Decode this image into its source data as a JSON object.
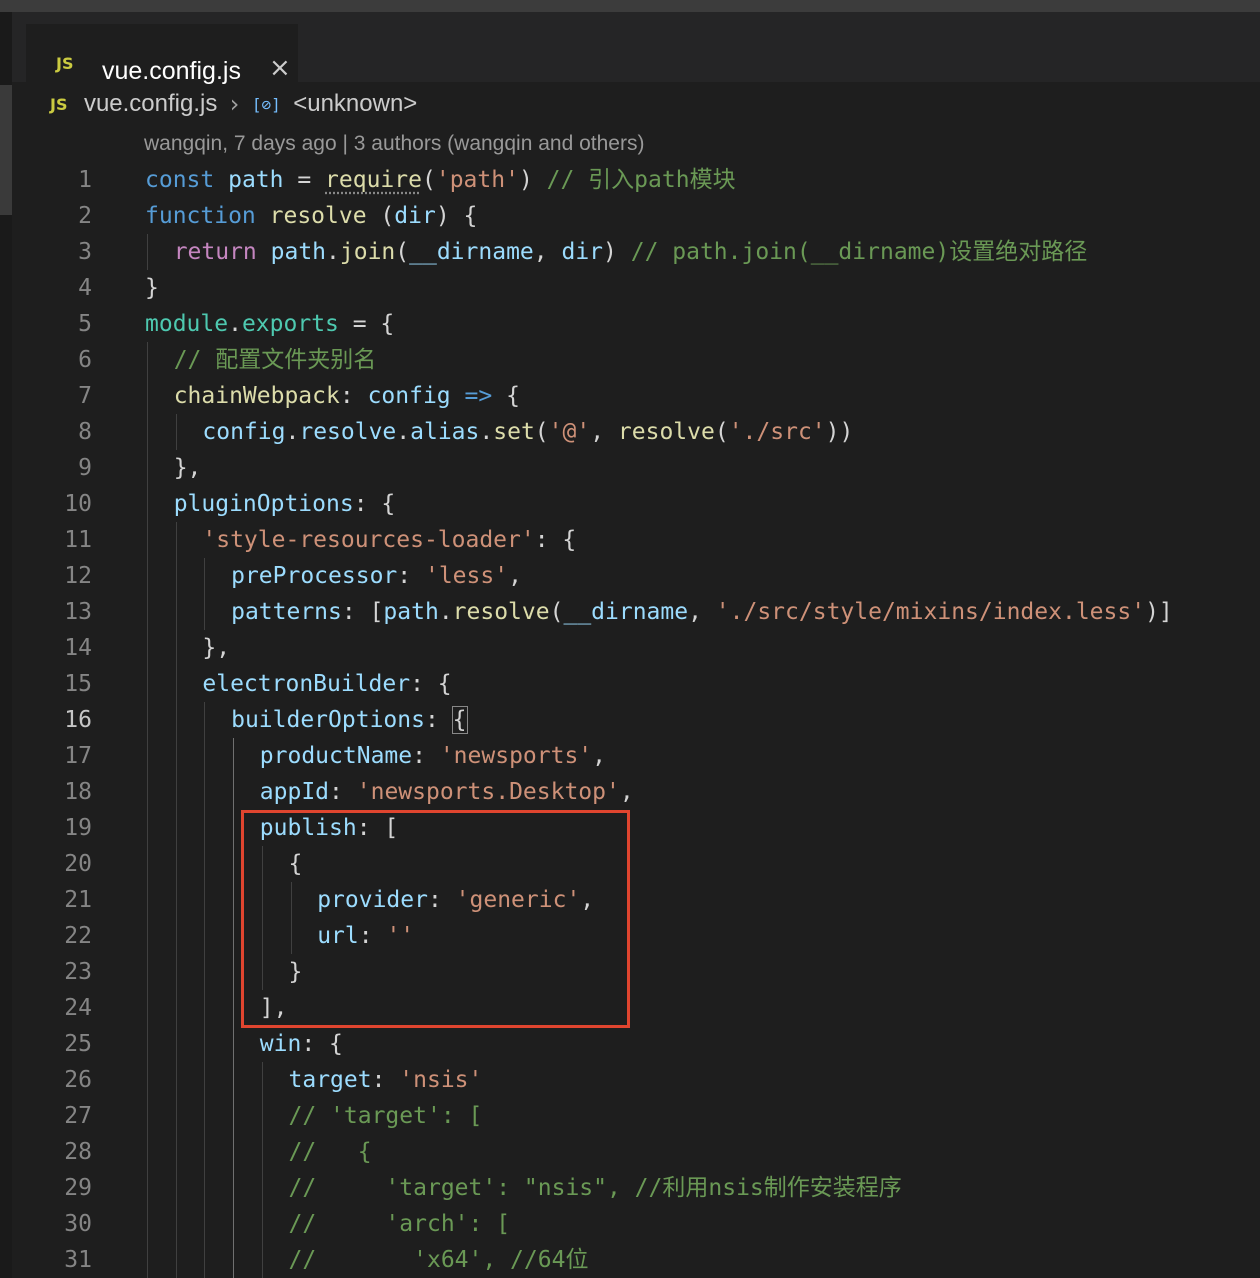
{
  "tab": {
    "icon": "JS",
    "title": "vue.config.js",
    "close": "×"
  },
  "breadcrumb": {
    "icon": "JS",
    "file": "vue.config.js",
    "separator": "›",
    "symbol_icon": "[⊘]",
    "symbol": "<unknown>"
  },
  "blame": "wangqin, 7 days ago | 3 authors (wangqin and others)",
  "colors": {
    "keyword": "#569cd6",
    "control": "#c586c0",
    "variable": "#9cdcfe",
    "function": "#dcdcaa",
    "string": "#ce9178",
    "comment": "#6a9955",
    "highlight": "#e0452f"
  },
  "code": {
    "lines": [
      {
        "n": "1",
        "indent": 0,
        "tokens": [
          [
            "kw",
            "const"
          ],
          [
            "punc",
            " "
          ],
          [
            "var",
            "path"
          ],
          [
            "punc",
            " = "
          ],
          [
            "fn",
            "require"
          ],
          [
            "punc",
            "("
          ],
          [
            "str",
            "'path'"
          ],
          [
            "punc",
            ") "
          ],
          [
            "com",
            "// 引入path模块"
          ]
        ]
      },
      {
        "n": "2",
        "indent": 0,
        "tokens": [
          [
            "kw",
            "function"
          ],
          [
            "punc",
            " "
          ],
          [
            "fn",
            "resolve"
          ],
          [
            "punc",
            " ("
          ],
          [
            "var",
            "dir"
          ],
          [
            "punc",
            ") {"
          ]
        ]
      },
      {
        "n": "3",
        "indent": 1,
        "tokens": [
          [
            "ctrl",
            "return"
          ],
          [
            "punc",
            " "
          ],
          [
            "var",
            "path"
          ],
          [
            "punc",
            "."
          ],
          [
            "fn",
            "join"
          ],
          [
            "punc",
            "("
          ],
          [
            "var",
            "__dirname"
          ],
          [
            "punc",
            ", "
          ],
          [
            "var",
            "dir"
          ],
          [
            "punc",
            ") "
          ],
          [
            "com",
            "// path.join(__dirname)设置绝对路径"
          ]
        ]
      },
      {
        "n": "4",
        "indent": 0,
        "tokens": [
          [
            "punc",
            "}"
          ]
        ]
      },
      {
        "n": "5",
        "indent": 0,
        "tokens": [
          [
            "mod",
            "module"
          ],
          [
            "punc",
            "."
          ],
          [
            "mod",
            "exports"
          ],
          [
            "punc",
            " = {"
          ]
        ]
      },
      {
        "n": "6",
        "indent": 1,
        "tokens": [
          [
            "com",
            "// 配置文件夹别名"
          ]
        ]
      },
      {
        "n": "7",
        "indent": 1,
        "tokens": [
          [
            "fn",
            "chainWebpack"
          ],
          [
            "punc",
            ": "
          ],
          [
            "var",
            "config"
          ],
          [
            "punc",
            " "
          ],
          [
            "kw",
            "=>"
          ],
          [
            "punc",
            " {"
          ]
        ]
      },
      {
        "n": "8",
        "indent": 2,
        "tokens": [
          [
            "var",
            "config"
          ],
          [
            "punc",
            "."
          ],
          [
            "var",
            "resolve"
          ],
          [
            "punc",
            "."
          ],
          [
            "var",
            "alias"
          ],
          [
            "punc",
            "."
          ],
          [
            "fn",
            "set"
          ],
          [
            "punc",
            "("
          ],
          [
            "str",
            "'@'"
          ],
          [
            "punc",
            ", "
          ],
          [
            "fn",
            "resolve"
          ],
          [
            "punc",
            "("
          ],
          [
            "str",
            "'./src'"
          ],
          [
            "punc",
            "))"
          ]
        ]
      },
      {
        "n": "9",
        "indent": 1,
        "tokens": [
          [
            "punc",
            "},"
          ]
        ]
      },
      {
        "n": "10",
        "indent": 1,
        "tokens": [
          [
            "prop",
            "pluginOptions"
          ],
          [
            "punc",
            ": {"
          ]
        ]
      },
      {
        "n": "11",
        "indent": 2,
        "tokens": [
          [
            "str",
            "'style-resources-loader'"
          ],
          [
            "punc",
            ": {"
          ]
        ]
      },
      {
        "n": "12",
        "indent": 3,
        "tokens": [
          [
            "prop",
            "preProcessor"
          ],
          [
            "punc",
            ": "
          ],
          [
            "str",
            "'less'"
          ],
          [
            "punc",
            ","
          ]
        ]
      },
      {
        "n": "13",
        "indent": 3,
        "tokens": [
          [
            "prop",
            "patterns"
          ],
          [
            "punc",
            ": ["
          ],
          [
            "var",
            "path"
          ],
          [
            "punc",
            "."
          ],
          [
            "fn",
            "resolve"
          ],
          [
            "punc",
            "("
          ],
          [
            "var",
            "__dirname"
          ],
          [
            "punc",
            ", "
          ],
          [
            "str",
            "'./src/style/mixins/index.less'"
          ],
          [
            "punc",
            ")]"
          ]
        ]
      },
      {
        "n": "14",
        "indent": 2,
        "tokens": [
          [
            "punc",
            "},"
          ]
        ]
      },
      {
        "n": "15",
        "indent": 2,
        "tokens": [
          [
            "prop",
            "electronBuilder"
          ],
          [
            "punc",
            ": {"
          ]
        ]
      },
      {
        "n": "16",
        "indent": 3,
        "tokens": [
          [
            "prop",
            "builderOptions"
          ],
          [
            "punc",
            ": "
          ],
          [
            "bracket",
            "{"
          ]
        ]
      },
      {
        "n": "17",
        "indent": 4,
        "tokens": [
          [
            "prop",
            "productName"
          ],
          [
            "punc",
            ": "
          ],
          [
            "str",
            "'newsports'"
          ],
          [
            "punc",
            ","
          ]
        ]
      },
      {
        "n": "18",
        "indent": 4,
        "tokens": [
          [
            "prop",
            "appId"
          ],
          [
            "punc",
            ": "
          ],
          [
            "str",
            "'newsports.Desktop'"
          ],
          [
            "punc",
            ","
          ]
        ]
      },
      {
        "n": "19",
        "indent": 4,
        "tokens": [
          [
            "prop",
            "publish"
          ],
          [
            "punc",
            ": ["
          ]
        ]
      },
      {
        "n": "20",
        "indent": 5,
        "tokens": [
          [
            "punc",
            "{"
          ]
        ]
      },
      {
        "n": "21",
        "indent": 6,
        "tokens": [
          [
            "prop",
            "provider"
          ],
          [
            "punc",
            ": "
          ],
          [
            "str",
            "'generic'"
          ],
          [
            "punc",
            ","
          ]
        ]
      },
      {
        "n": "22",
        "indent": 6,
        "tokens": [
          [
            "prop",
            "url"
          ],
          [
            "punc",
            ": "
          ],
          [
            "str",
            "''"
          ]
        ]
      },
      {
        "n": "23",
        "indent": 5,
        "tokens": [
          [
            "punc",
            "}"
          ]
        ]
      },
      {
        "n": "24",
        "indent": 4,
        "tokens": [
          [
            "punc",
            "],"
          ]
        ]
      },
      {
        "n": "25",
        "indent": 4,
        "tokens": [
          [
            "prop",
            "win"
          ],
          [
            "punc",
            ": {"
          ]
        ]
      },
      {
        "n": "26",
        "indent": 5,
        "tokens": [
          [
            "prop",
            "target"
          ],
          [
            "punc",
            ": "
          ],
          [
            "str",
            "'nsis'"
          ]
        ]
      },
      {
        "n": "27",
        "indent": 5,
        "tokens": [
          [
            "com",
            "// 'target': ["
          ]
        ]
      },
      {
        "n": "28",
        "indent": 5,
        "tokens": [
          [
            "com",
            "//   {"
          ]
        ]
      },
      {
        "n": "29",
        "indent": 5,
        "tokens": [
          [
            "com",
            "//     'target': \"nsis\", //利用nsis制作安装程序"
          ]
        ]
      },
      {
        "n": "30",
        "indent": 5,
        "tokens": [
          [
            "com",
            "//     'arch': ["
          ]
        ]
      },
      {
        "n": "31",
        "indent": 5,
        "tokens": [
          [
            "com",
            "//       'x64', //64位"
          ]
        ]
      }
    ]
  }
}
